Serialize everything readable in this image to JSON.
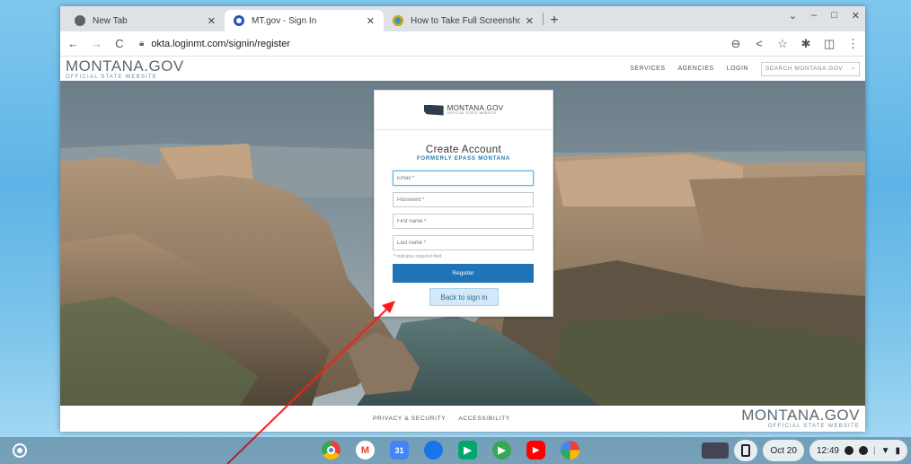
{
  "browser": {
    "tabs": [
      {
        "title": "New Tab",
        "active": false,
        "favicon_color": "#5f6368"
      },
      {
        "title": "MT.gov - Sign In",
        "active": true,
        "favicon_color": "#1a56b8"
      },
      {
        "title": "How to Take Full Screenshots - C",
        "active": false,
        "favicon_color": "#2a9d8f"
      }
    ],
    "new_tab_symbol": "+",
    "window_controls": [
      "⌄",
      "–",
      "□",
      "✕"
    ],
    "url": "okta.loginmt.com/signin/register"
  },
  "site": {
    "brand_name": "MONTANA.GOV",
    "brand_sub": "OFFICIAL STATE WEBSITE",
    "nav": {
      "services": "SERVICES",
      "agencies": "AGENCIES",
      "login": "LOGIN",
      "search_placeholder": "SEARCH MONTANA.GOV"
    },
    "footer": {
      "privacy": "PRIVACY & SECURITY",
      "accessibility": "ACCESSIBILITY",
      "brand_name": "MONTANA.GOV",
      "brand_sub": "OFFICIAL STATE WEBSITE"
    }
  },
  "form": {
    "logo_text": "MONTANA.GOV",
    "logo_sub": "OFFICIAL STATE WEBSITE",
    "title": "Create Account",
    "subtitle": "FORMERLY EPASS MONTANA",
    "email_placeholder": "Email *",
    "password_placeholder": "Password *",
    "first_name_placeholder": "First name *",
    "last_name_placeholder": "Last name *",
    "required_note": "* indicates required field",
    "register_label": "Register",
    "back_label": "Back to sign in"
  },
  "taskbar": {
    "apps": [
      {
        "name": "chrome",
        "color": "#e8453c",
        "glyph": "◉"
      },
      {
        "name": "gmail",
        "color": "#ffffff",
        "glyph": "M"
      },
      {
        "name": "calendar",
        "color": "#4285f4",
        "glyph": "31"
      },
      {
        "name": "files",
        "color": "#1a73e8",
        "glyph": "▬"
      },
      {
        "name": "meet",
        "color": "#00a86b",
        "glyph": "▶"
      },
      {
        "name": "play-store",
        "color": "#34a853",
        "glyph": "▶"
      },
      {
        "name": "youtube",
        "color": "#ff0000",
        "glyph": "▶"
      },
      {
        "name": "photos",
        "color": "#fbbc04",
        "glyph": "✿"
      }
    ],
    "date": "Oct 20",
    "time": "12:49"
  }
}
